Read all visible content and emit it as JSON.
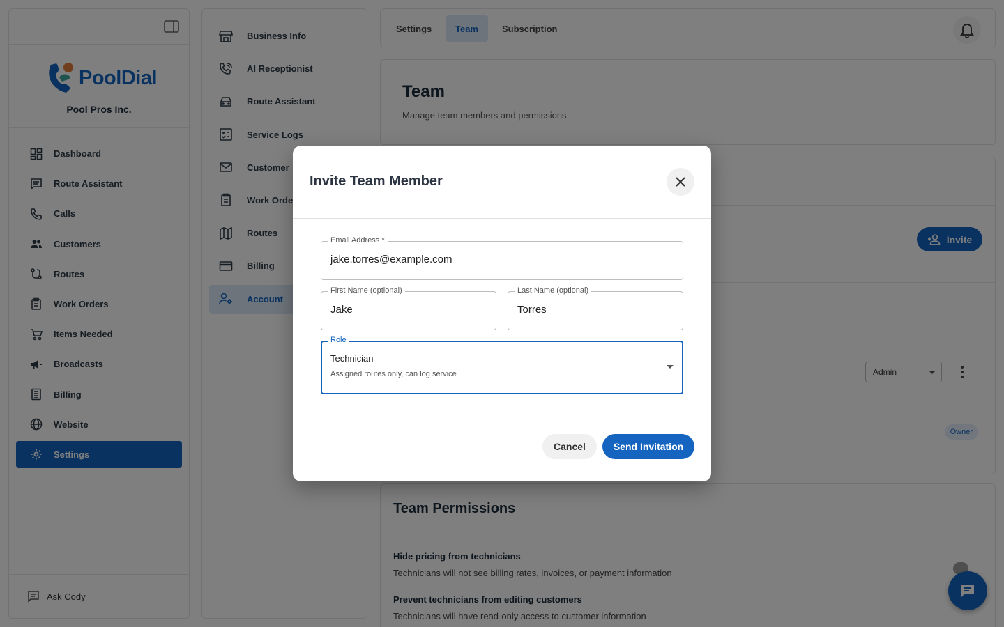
{
  "sidebar": {
    "brand": "PoolDial",
    "company": "Pool Pros Inc.",
    "items": [
      {
        "label": "Dashboard",
        "icon": "dashboard-icon"
      },
      {
        "label": "Route Assistant",
        "icon": "chat-icon"
      },
      {
        "label": "Calls",
        "icon": "phone-icon"
      },
      {
        "label": "Customers",
        "icon": "people-icon"
      },
      {
        "label": "Routes",
        "icon": "route-icon"
      },
      {
        "label": "Work Orders",
        "icon": "clipboard-icon"
      },
      {
        "label": "Items Needed",
        "icon": "cart-icon"
      },
      {
        "label": "Broadcasts",
        "icon": "megaphone-icon"
      },
      {
        "label": "Billing",
        "icon": "receipt-icon"
      },
      {
        "label": "Website",
        "icon": "globe-icon"
      },
      {
        "label": "Settings",
        "icon": "gear-icon",
        "active": true
      }
    ],
    "ask": "Ask Cody"
  },
  "settings_nav": {
    "items": [
      {
        "label": "Business Info",
        "icon": "store-icon"
      },
      {
        "label": "AI Receptionist",
        "icon": "phone-call-icon"
      },
      {
        "label": "Route Assistant",
        "icon": "car-icon"
      },
      {
        "label": "Service Logs",
        "icon": "checklist-icon"
      },
      {
        "label": "Customer",
        "icon": "mail-icon"
      },
      {
        "label": "Work Orde",
        "icon": "clipboard-icon"
      },
      {
        "label": "Routes",
        "icon": "map-icon"
      },
      {
        "label": "Billing",
        "icon": "credit-card-icon"
      },
      {
        "label": "Account",
        "icon": "manage-accounts-icon",
        "active": true
      }
    ]
  },
  "tabs": [
    {
      "label": "Settings"
    },
    {
      "label": "Team",
      "active": true
    },
    {
      "label": "Subscription"
    }
  ],
  "header": {
    "title": "Team",
    "subtitle": "Manage team members and permissions"
  },
  "members": {
    "invite_label": "Invite",
    "row1_role": "Admin",
    "row2_badge": "Owner"
  },
  "permissions": {
    "title": "Team Permissions",
    "items": [
      {
        "label": "Hide pricing from technicians",
        "desc": "Technicians will not see billing rates, invoices, or payment information"
      },
      {
        "label": "Prevent technicians from editing customers",
        "desc": "Technicians will have read-only access to customer information"
      }
    ]
  },
  "dialog": {
    "title": "Invite Team Member",
    "email": {
      "label": "Email Address *",
      "value": "jake.torres@example.com"
    },
    "first_name": {
      "label": "First Name (optional)",
      "value": "Jake"
    },
    "last_name": {
      "label": "Last Name (optional)",
      "value": "Torres"
    },
    "role": {
      "label": "Role",
      "value": "Technician",
      "description": "Assigned routes only, can log service"
    },
    "cancel": "Cancel",
    "send": "Send Invitation"
  },
  "colors": {
    "accent": "#1565c0",
    "accent_light": "#dbe8f7",
    "overlay": "rgba(0,0,0,0.5)"
  }
}
